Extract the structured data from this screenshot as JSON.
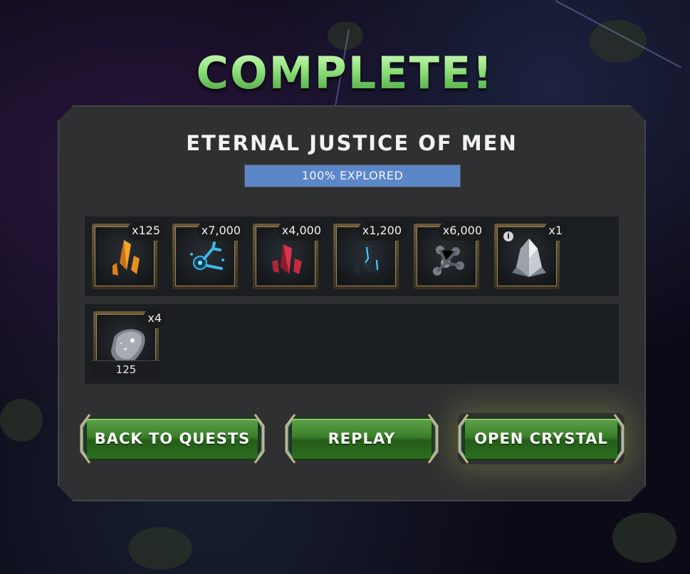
{
  "header": {
    "title": "COMPLETE!"
  },
  "quest": {
    "name": "ETERNAL JUSTICE OF MEN",
    "progress_percent": 100,
    "progress_label": "100% EXPLORED"
  },
  "rewards": {
    "row1": [
      {
        "icon": "gold-shard-icon",
        "count": "x125"
      },
      {
        "icon": "blue-catalyst-icon",
        "count": "x7,000"
      },
      {
        "icon": "red-shard-icon",
        "count": "x4,000"
      },
      {
        "icon": "cyan-shard-icon",
        "count": "x1,200"
      },
      {
        "icon": "gray-catalyst-icon",
        "count": "x6,000"
      },
      {
        "icon": "crystal-icon",
        "count": "x1",
        "info": "i"
      }
    ],
    "row2": [
      {
        "icon": "silver-fragment-icon",
        "count": "x4",
        "sub": "125"
      }
    ]
  },
  "buttons": {
    "back": "BACK TO QUESTS",
    "replay": "REPLAY",
    "open": "OPEN CRYSTAL"
  },
  "colors": {
    "title_green": "#8fdc7a",
    "progress_blue": "#5b87c9",
    "button_green": "#3c7f2b",
    "panel": "#2f3032"
  }
}
